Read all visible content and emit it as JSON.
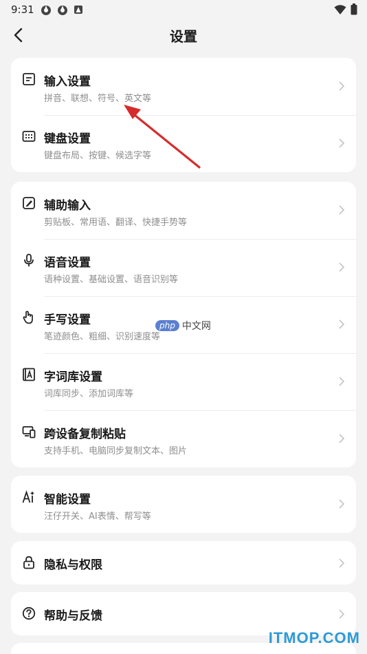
{
  "status_bar": {
    "time": "9:31"
  },
  "header": {
    "title": "设置"
  },
  "groups": [
    {
      "items": [
        {
          "label": "输入设置",
          "sub": "拼音、联想、符号、英文等",
          "icon": "keyboard-settings-icon"
        },
        {
          "label": "键盘设置",
          "sub": "键盘布局、按键、候选字等",
          "icon": "keyboard-icon"
        }
      ]
    },
    {
      "items": [
        {
          "label": "辅助输入",
          "sub": "剪贴板、常用语、翻译、快捷手势等",
          "icon": "edit-assist-icon"
        },
        {
          "label": "语音设置",
          "sub": "语种设置、基础设置、语音识别等",
          "icon": "microphone-icon"
        },
        {
          "label": "手写设置",
          "sub": "笔迹颜色、粗细、识别速度等",
          "icon": "hand-icon"
        },
        {
          "label": "字词库设置",
          "sub": "词库同步、添加词库等",
          "icon": "dictionary-icon"
        },
        {
          "label": "跨设备复制粘贴",
          "sub": "支持手机、电脑同步复制文本、图片",
          "icon": "devices-icon"
        }
      ]
    },
    {
      "items": [
        {
          "label": "智能设置",
          "sub": "汪仔开关、AI表情、帮写等",
          "icon": "ai-icon"
        }
      ]
    },
    {
      "items": [
        {
          "label": "隐私与权限",
          "icon": "lock-icon"
        }
      ]
    },
    {
      "items": [
        {
          "label": "帮助与反馈",
          "icon": "help-icon"
        }
      ]
    }
  ],
  "watermark": {
    "badge": "php",
    "text": "中文网"
  },
  "site_mark": "ITMOP.COM",
  "colors": {
    "accent_arrow": "#d62c2c",
    "background": "#f3f3f3",
    "card": "#ffffff",
    "subtext": "#8e8e8e"
  }
}
